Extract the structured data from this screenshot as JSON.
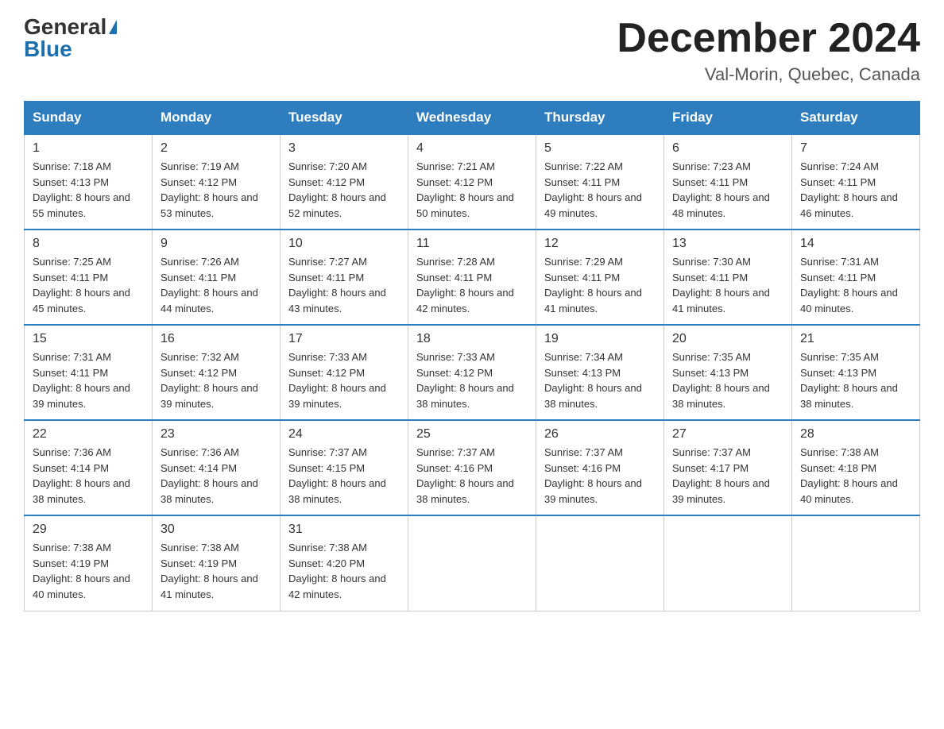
{
  "header": {
    "logo_general": "General",
    "logo_blue": "Blue",
    "month_title": "December 2024",
    "location": "Val-Morin, Quebec, Canada"
  },
  "days_of_week": [
    "Sunday",
    "Monday",
    "Tuesday",
    "Wednesday",
    "Thursday",
    "Friday",
    "Saturday"
  ],
  "weeks": [
    [
      {
        "day": "1",
        "sunrise": "7:18 AM",
        "sunset": "4:13 PM",
        "daylight": "8 hours and 55 minutes."
      },
      {
        "day": "2",
        "sunrise": "7:19 AM",
        "sunset": "4:12 PM",
        "daylight": "8 hours and 53 minutes."
      },
      {
        "day": "3",
        "sunrise": "7:20 AM",
        "sunset": "4:12 PM",
        "daylight": "8 hours and 52 minutes."
      },
      {
        "day": "4",
        "sunrise": "7:21 AM",
        "sunset": "4:12 PM",
        "daylight": "8 hours and 50 minutes."
      },
      {
        "day": "5",
        "sunrise": "7:22 AM",
        "sunset": "4:11 PM",
        "daylight": "8 hours and 49 minutes."
      },
      {
        "day": "6",
        "sunrise": "7:23 AM",
        "sunset": "4:11 PM",
        "daylight": "8 hours and 48 minutes."
      },
      {
        "day": "7",
        "sunrise": "7:24 AM",
        "sunset": "4:11 PM",
        "daylight": "8 hours and 46 minutes."
      }
    ],
    [
      {
        "day": "8",
        "sunrise": "7:25 AM",
        "sunset": "4:11 PM",
        "daylight": "8 hours and 45 minutes."
      },
      {
        "day": "9",
        "sunrise": "7:26 AM",
        "sunset": "4:11 PM",
        "daylight": "8 hours and 44 minutes."
      },
      {
        "day": "10",
        "sunrise": "7:27 AM",
        "sunset": "4:11 PM",
        "daylight": "8 hours and 43 minutes."
      },
      {
        "day": "11",
        "sunrise": "7:28 AM",
        "sunset": "4:11 PM",
        "daylight": "8 hours and 42 minutes."
      },
      {
        "day": "12",
        "sunrise": "7:29 AM",
        "sunset": "4:11 PM",
        "daylight": "8 hours and 41 minutes."
      },
      {
        "day": "13",
        "sunrise": "7:30 AM",
        "sunset": "4:11 PM",
        "daylight": "8 hours and 41 minutes."
      },
      {
        "day": "14",
        "sunrise": "7:31 AM",
        "sunset": "4:11 PM",
        "daylight": "8 hours and 40 minutes."
      }
    ],
    [
      {
        "day": "15",
        "sunrise": "7:31 AM",
        "sunset": "4:11 PM",
        "daylight": "8 hours and 39 minutes."
      },
      {
        "day": "16",
        "sunrise": "7:32 AM",
        "sunset": "4:12 PM",
        "daylight": "8 hours and 39 minutes."
      },
      {
        "day": "17",
        "sunrise": "7:33 AM",
        "sunset": "4:12 PM",
        "daylight": "8 hours and 39 minutes."
      },
      {
        "day": "18",
        "sunrise": "7:33 AM",
        "sunset": "4:12 PM",
        "daylight": "8 hours and 38 minutes."
      },
      {
        "day": "19",
        "sunrise": "7:34 AM",
        "sunset": "4:13 PM",
        "daylight": "8 hours and 38 minutes."
      },
      {
        "day": "20",
        "sunrise": "7:35 AM",
        "sunset": "4:13 PM",
        "daylight": "8 hours and 38 minutes."
      },
      {
        "day": "21",
        "sunrise": "7:35 AM",
        "sunset": "4:13 PM",
        "daylight": "8 hours and 38 minutes."
      }
    ],
    [
      {
        "day": "22",
        "sunrise": "7:36 AM",
        "sunset": "4:14 PM",
        "daylight": "8 hours and 38 minutes."
      },
      {
        "day": "23",
        "sunrise": "7:36 AM",
        "sunset": "4:14 PM",
        "daylight": "8 hours and 38 minutes."
      },
      {
        "day": "24",
        "sunrise": "7:37 AM",
        "sunset": "4:15 PM",
        "daylight": "8 hours and 38 minutes."
      },
      {
        "day": "25",
        "sunrise": "7:37 AM",
        "sunset": "4:16 PM",
        "daylight": "8 hours and 38 minutes."
      },
      {
        "day": "26",
        "sunrise": "7:37 AM",
        "sunset": "4:16 PM",
        "daylight": "8 hours and 39 minutes."
      },
      {
        "day": "27",
        "sunrise": "7:37 AM",
        "sunset": "4:17 PM",
        "daylight": "8 hours and 39 minutes."
      },
      {
        "day": "28",
        "sunrise": "7:38 AM",
        "sunset": "4:18 PM",
        "daylight": "8 hours and 40 minutes."
      }
    ],
    [
      {
        "day": "29",
        "sunrise": "7:38 AM",
        "sunset": "4:19 PM",
        "daylight": "8 hours and 40 minutes."
      },
      {
        "day": "30",
        "sunrise": "7:38 AM",
        "sunset": "4:19 PM",
        "daylight": "8 hours and 41 minutes."
      },
      {
        "day": "31",
        "sunrise": "7:38 AM",
        "sunset": "4:20 PM",
        "daylight": "8 hours and 42 minutes."
      },
      null,
      null,
      null,
      null
    ]
  ]
}
